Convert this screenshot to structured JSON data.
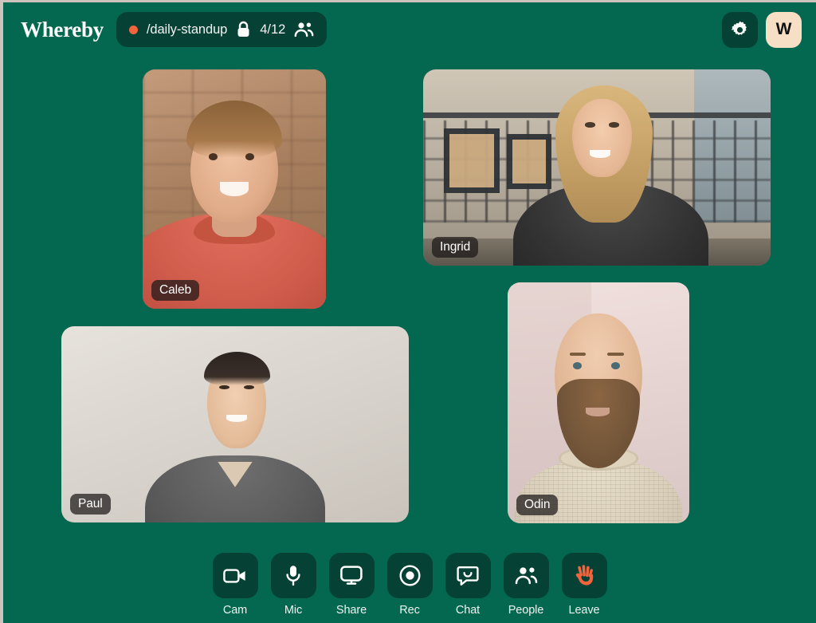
{
  "app": {
    "name": "Whereby",
    "brand_color": "#03684F",
    "panel_color": "#054135",
    "accent_color": "#F2643C",
    "avatar_bg": "#F7DFC5"
  },
  "header": {
    "logo_text": "Whereby",
    "room": {
      "recording_dot": "record-dot",
      "name": "/daily-standup",
      "lock_icon": "lock-icon",
      "participant_count": "4/12",
      "people_icon": "people-icon"
    },
    "settings_button": {
      "icon": "gear-icon",
      "label": "Settings"
    },
    "avatar_button": {
      "initial": "W",
      "label": "Account"
    }
  },
  "stage": {
    "tiles": [
      {
        "id": "caleb",
        "name": "Caleb"
      },
      {
        "id": "ingrid",
        "name": "Ingrid"
      },
      {
        "id": "paul",
        "name": "Paul"
      },
      {
        "id": "odin",
        "name": "Odin"
      }
    ]
  },
  "toolbar": {
    "buttons": [
      {
        "icon": "camera-icon",
        "label": "Cam"
      },
      {
        "icon": "microphone-icon",
        "label": "Mic"
      },
      {
        "icon": "screen-icon",
        "label": "Share"
      },
      {
        "icon": "record-icon",
        "label": "Rec"
      },
      {
        "icon": "chat-icon",
        "label": "Chat"
      },
      {
        "icon": "people-icon",
        "label": "People"
      },
      {
        "icon": "wave-hand-icon",
        "label": "Leave"
      }
    ]
  }
}
